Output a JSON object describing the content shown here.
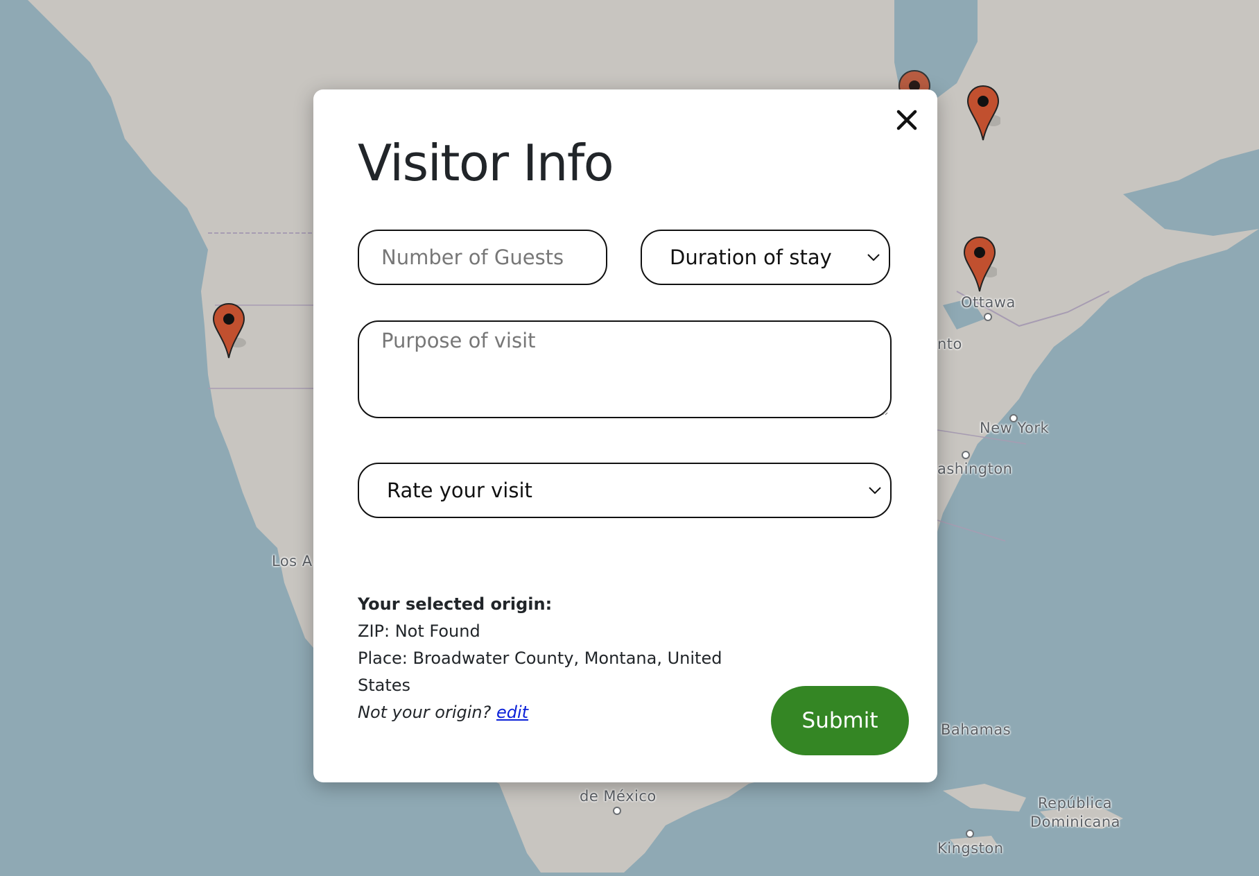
{
  "map": {
    "labels": {
      "ottawa": "Ottawa",
      "toronto_partial": "nto",
      "new_york": "New York",
      "washington_partial": "ashington",
      "los_angeles_partial": "Los A",
      "bahamas": "Bahamas",
      "mexico_city_partial": "de México",
      "republica": "República",
      "dominicana": "Dominicana",
      "kingston": "Kingston"
    },
    "marker_color": "#c1502f",
    "water_color": "#8fa9b4",
    "land_color": "#c8c5c0"
  },
  "modal": {
    "title": "Visitor Info",
    "close_icon": "close-icon",
    "guests_placeholder": "Number of Guests",
    "duration_selected": "Duration of stay",
    "purpose_placeholder": "Purpose of visit",
    "rating_selected": "Rate your visit",
    "origin": {
      "heading": "Your selected origin:",
      "zip": "ZIP: Not Found",
      "place": "Place: Broadwater County, Montana, United States",
      "prompt": "Not your origin?",
      "edit_link": "edit"
    },
    "submit_label": "Submit",
    "submit_color": "#348624"
  }
}
